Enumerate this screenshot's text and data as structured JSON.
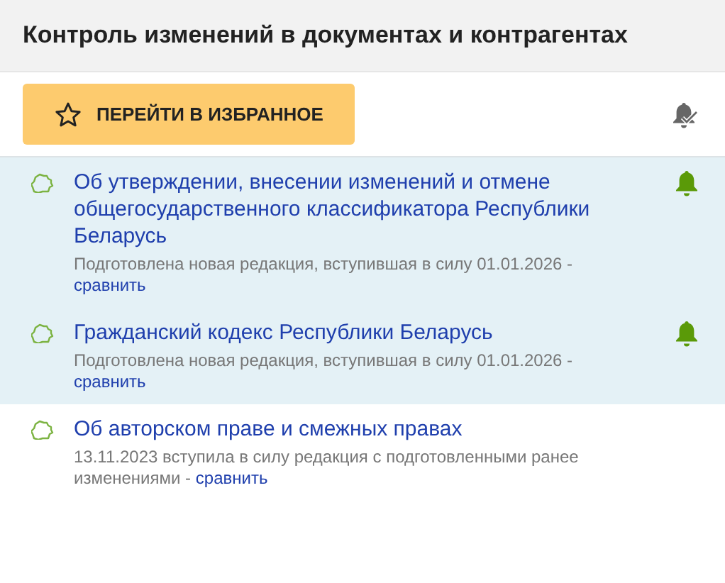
{
  "header": {
    "title": "Контроль изменений в документах и контрагентах"
  },
  "favorites_button": {
    "label": "ПЕРЕЙТИ В ИЗБРАННОЕ"
  },
  "documents": [
    {
      "title": "Об утверждении, внесении изменений и отмене общегосударственного классификатора Республики Беларусь",
      "note": "Подготовлена новая редакция, вступившая в силу 01.01.2026 -",
      "link": "сравнить",
      "highlighted": true,
      "bell": true
    },
    {
      "title": "Гражданский кодекс Республики Беларусь",
      "note": "Подготовлена новая редакция, вступившая в силу 01.01.2026 -",
      "link": "сравнить",
      "highlighted": true,
      "bell": true
    },
    {
      "title": "Об авторском праве и смежных правах",
      "note": "13.11.2023 вступила в силу редакция с подготовленными ранее изменениями -",
      "link": "сравнить",
      "highlighted": false,
      "bell": false
    }
  ]
}
